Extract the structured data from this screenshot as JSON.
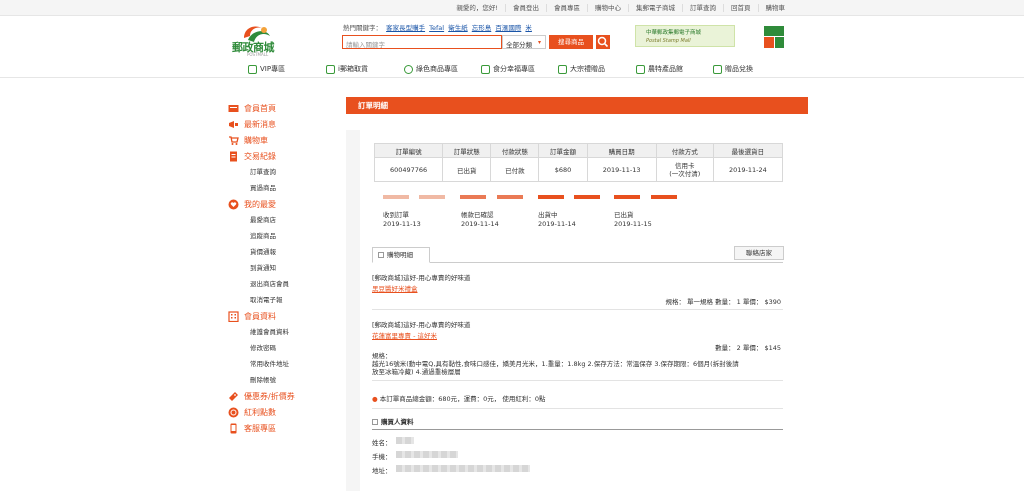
{
  "topbar": {
    "greeting": "親愛的，您好!",
    "links": [
      "會員登出",
      "會員專區",
      "購物中心",
      "集郵電子商城",
      "訂單查詢",
      "回首頁",
      "購物車"
    ]
  },
  "header": {
    "logo_text": "郵政商城",
    "logo_sub": "POSTMALL",
    "hot_label": "熱門關鍵字：",
    "hot_keywords": [
      "客家長型購手",
      "Tefal",
      "衛生紙",
      "忘形島",
      "百滙國際",
      "米"
    ],
    "search_placeholder": "請輸入關鍵字",
    "search_scope": "全部分類",
    "search_button": "搜尋商品",
    "banner_line1": "中華郵政集郵電子商城",
    "banner_line2": "Postal Stamp Mall",
    "gift_label": "郵便 農產行銷"
  },
  "nav": [
    "VIP專區",
    "i郵箱取貨",
    "綠色商品專區",
    "食分幸福專區",
    "大宗禮贈品",
    "農特產品館",
    "贈品兌換"
  ],
  "sidebar": [
    {
      "label": "會員首頁",
      "subs": []
    },
    {
      "label": "最新消息",
      "subs": []
    },
    {
      "label": "購物車",
      "subs": []
    },
    {
      "label": "交易紀錄",
      "subs": [
        "訂單查詢",
        "買過商品"
      ]
    },
    {
      "label": "我的最愛",
      "subs": [
        "最愛商店",
        "追蹤商品",
        "貨價通報",
        "到貨通知",
        "退出商店會員",
        "取消電子報"
      ]
    },
    {
      "label": "會員資料",
      "subs": [
        "維護會員資料",
        "修改密碼",
        "常用收件地址",
        "刪除帳號"
      ]
    },
    {
      "label": "優惠券/折價券",
      "subs": []
    },
    {
      "label": "紅利點數",
      "subs": []
    },
    {
      "label": "客服專區",
      "subs": []
    }
  ],
  "order": {
    "title": "訂單明細",
    "headers": [
      "訂單編號",
      "訂單狀態",
      "付款狀態",
      "訂單金額",
      "購買日期",
      "付款方式",
      "最後選貨日"
    ],
    "values": [
      "600497766",
      "已出貨",
      "已付款",
      "$680",
      "2019-11-13",
      "信用卡\n(一次付清)",
      "2019-11-24"
    ],
    "steps": [
      {
        "label": "收到訂單",
        "date": "2019-11-13"
      },
      {
        "label": "帳款已確認",
        "date": "2019-11-14"
      },
      {
        "label": "出貨中",
        "date": "2019-11-14"
      },
      {
        "label": "已出貨",
        "date": "2019-11-15"
      }
    ],
    "tab_label": "購物明細",
    "contact_button": "聯絡店家",
    "item1_shop": "[郵政商城]這好-用心專賣的好味道",
    "item1_name": "黑豆醬好米禮盒",
    "item1_spec": "規格：  單一規格  數量：  1  單價：  $390",
    "item2_shop": "[郵政商城]這好-用心專賣的好味道",
    "item2_name": "花蓮富里專賣 - 這好米",
    "item2_qty": "數量：  2  單價：  $145",
    "item2_spec_label": "規格：",
    "item2_spec1": "越光16號米(動中電Q,具有黏性,食味口感佳，嬌美月光米，1.重量：1.8kg 2.保存方法：常溫保存 3.保存期限：6個月(拆封後請",
    "item2_spec2": "放至冰箱冷藏) 4.通過重檢層層",
    "total_text": "本訂單商品總金額：680元，運費：0元， 使用紅利：0點",
    "buyer_title": "購買人資料",
    "buyer_fields": [
      "姓名：",
      "手機：",
      "地址："
    ]
  },
  "colors": {
    "accent": "#e8501e",
    "brand_green": "#2f8b3a",
    "progress_light": "#f0b9a4"
  }
}
